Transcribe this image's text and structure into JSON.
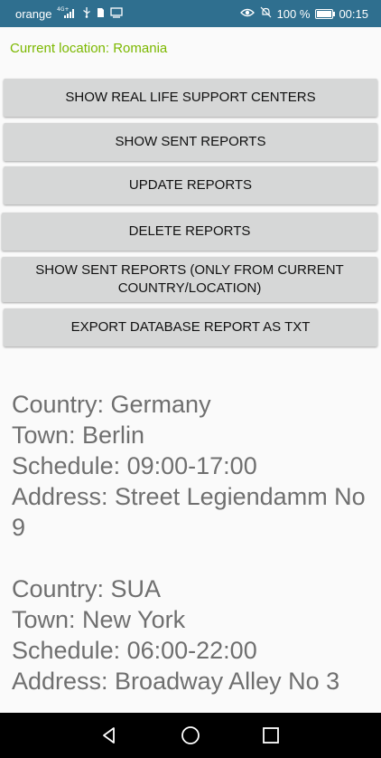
{
  "status_bar": {
    "carrier": "orange",
    "network": "4G+",
    "battery": "100 %",
    "battery_level": 1.0,
    "time": "00:15",
    "background_color": "#2f6f8f"
  },
  "location": {
    "label": "Current location: Romania",
    "color": "#7cb800"
  },
  "buttons": {
    "show_support_centers": "SHOW REAL LIFE SUPPORT CENTERS",
    "show_sent_reports": "SHOW SENT REPORTS",
    "update_reports": "UPDATE REPORTS",
    "delete_reports": "DELETE REPORTS",
    "show_sent_reports_location": "SHOW SENT REPORTS (ONLY FROM CURRENT COUNTRY/LOCATION)",
    "export_database": "EXPORT DATABASE REPORT AS TXT"
  },
  "centers": [
    {
      "country": "Country: Germany",
      "town": "Town: Berlin",
      "schedule": "Schedule: 09:00-17:00",
      "address": "Address: Street Legiendamm No 9"
    },
    {
      "country": "Country: SUA",
      "town": "Town: New York",
      "schedule": "Schedule: 06:00-22:00",
      "address": "Address: Broadway Alley No 3"
    }
  ],
  "icons": {
    "usb": "usb-icon",
    "sim": "sim-card-icon",
    "screen": "screen-icon",
    "eye": "eye-comfort-icon",
    "mute": "notifications-off-icon",
    "back": "back-triangle-icon",
    "home": "home-circle-icon",
    "recents": "recents-square-icon"
  }
}
